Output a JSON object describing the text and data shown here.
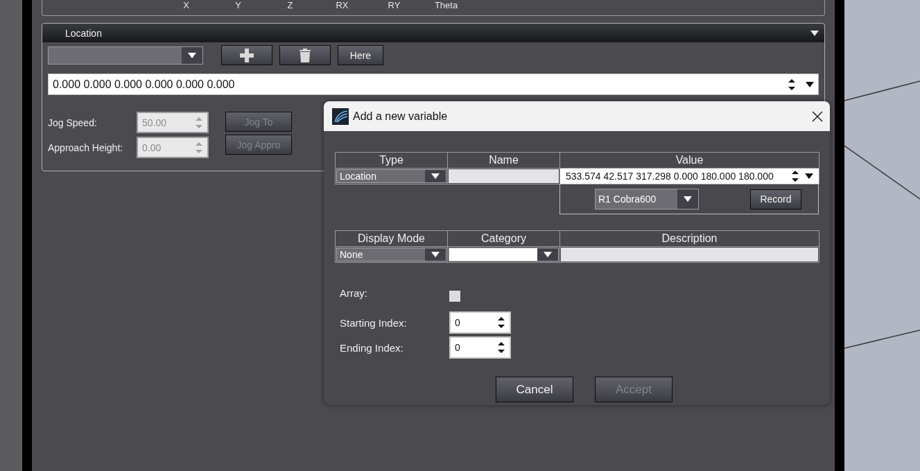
{
  "axis_labels": [
    "X",
    "Y",
    "Z",
    "RX",
    "RY",
    "Theta"
  ],
  "location_panel": {
    "title": "Location",
    "expanded": true,
    "buttons": [
      {
        "kind": "add"
      },
      {
        "kind": "delete"
      },
      {
        "kind": "text",
        "label": "Here"
      }
    ],
    "value": "0.000 0.000 0.000 0.000 0.000 0.000",
    "jog_fields": [
      {
        "label": "Jog Speed:",
        "value": "50.00",
        "disabled": true
      },
      {
        "label": "Approach Height:",
        "value": "0.00",
        "disabled": true
      }
    ],
    "jog_buttons": [
      {
        "label": "Jog To",
        "disabled": true
      },
      {
        "label": "Jog Appro",
        "disabled": true
      }
    ]
  },
  "dialog": {
    "title": "Add a new variable",
    "table1": {
      "columns": [
        "Type",
        "Name",
        "Value"
      ],
      "type": "Location",
      "value": "533.574 42.517 317.298 0.000 180.000 180.000",
      "robot": "R1 Cobra600",
      "record_button": "Record"
    },
    "table2": {
      "columns": [
        "Display Mode",
        "Category",
        "Description"
      ],
      "display_mode": "None"
    },
    "array": {
      "label": "Array:",
      "checked": false
    },
    "indices": [
      {
        "label": "Starting Index:",
        "value": "0"
      },
      {
        "label": "Ending Index:",
        "value": "0"
      }
    ],
    "buttons": [
      {
        "label": "Cancel",
        "disabled": false
      },
      {
        "label": "Accept",
        "disabled": true
      }
    ]
  }
}
